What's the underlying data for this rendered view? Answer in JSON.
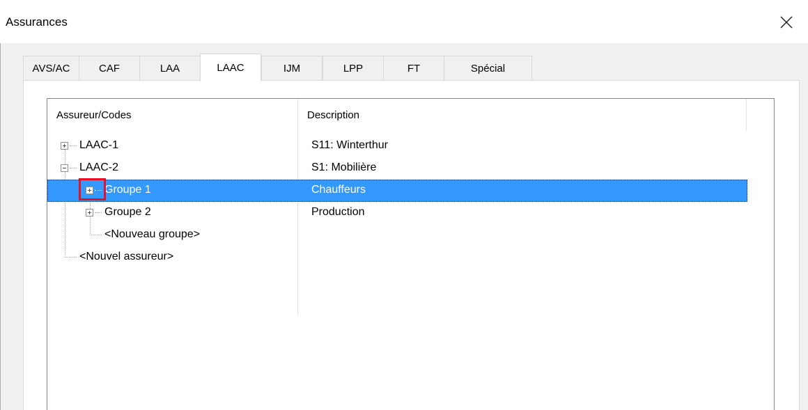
{
  "window": {
    "title": "Assurances"
  },
  "tabs": [
    {
      "label": "AVS/AC"
    },
    {
      "label": "CAF"
    },
    {
      "label": "LAA"
    },
    {
      "label": "LAAC",
      "active": true
    },
    {
      "label": "IJM"
    },
    {
      "label": "LPP"
    },
    {
      "label": "FT"
    },
    {
      "label": "Spécial"
    }
  ],
  "listview": {
    "columns": [
      "Assureur/Codes",
      "Description"
    ],
    "rows": [
      {
        "name": "LAAC-1",
        "description": "S11: Winterthur",
        "level": 0,
        "expander": "plus"
      },
      {
        "name": "LAAC-2",
        "description": "S1: Mobilière",
        "level": 0,
        "expander": "minus"
      },
      {
        "name": "Groupe 1",
        "description": "Chauffeurs",
        "level": 1,
        "expander": "plus",
        "selected": true
      },
      {
        "name": "Groupe 2",
        "description": "Production",
        "level": 1,
        "expander": "plus"
      },
      {
        "name": "<Nouveau groupe>",
        "description": "",
        "level": 1,
        "expander": "none"
      },
      {
        "name": "<Nouvel assureur>",
        "description": "",
        "level": 0,
        "expander": "none"
      }
    ]
  },
  "colors": {
    "selection": "#3399ff",
    "highlight_box": "#e81123"
  },
  "icons": {
    "close": "close-icon"
  }
}
